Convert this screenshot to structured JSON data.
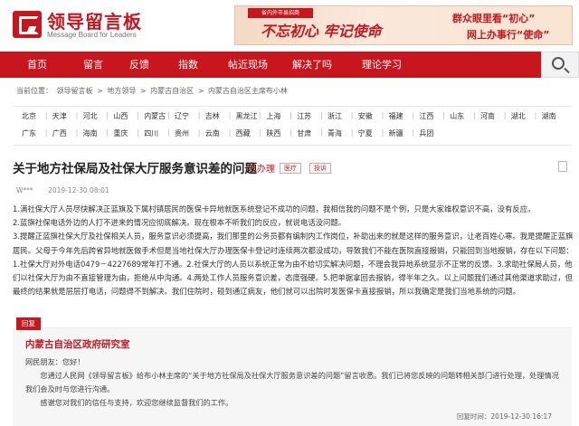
{
  "logo": {
    "cn": "领导留言板",
    "en": "Message Board for Leaders"
  },
  "banner": {
    "badge": "省内外市县招商",
    "slogan": "不忘初心 牢记使命",
    "line1": "群众眼里看“初心”",
    "line2": "网上办事行“使命”"
  },
  "nav": [
    "首页",
    "留言",
    "反馈",
    "指数",
    "帖近现场",
    "解决了吗",
    "理论学习"
  ],
  "breadcrumb": [
    "当前位置：",
    "领导留言板",
    ">",
    "地方领导",
    ">",
    "内蒙古自治区",
    ">",
    "内蒙古自治区主席布小林"
  ],
  "regions": {
    "row1": [
      "北京",
      "天津",
      "河北",
      "山西",
      "内蒙古",
      "辽宁",
      "吉林",
      "黑龙江",
      "上海",
      "江苏",
      "浙江",
      "安徽",
      "福建",
      "江西",
      "山东",
      "河南",
      "湖北",
      "湖南"
    ],
    "row2": [
      "广东",
      "广西",
      "海南",
      "重庆",
      "四川",
      "贵州",
      "云南",
      "西藏",
      "陕西",
      "甘肃",
      "青海",
      "宁夏",
      "新疆",
      "兵团"
    ]
  },
  "post": {
    "title": "关于地方社保局及社保大厅服务意识差的问题",
    "status": "已办理",
    "tags": [
      "医疗",
      "投诉"
    ],
    "author": "W***",
    "date": "2019-12-30 08:01",
    "paragraphs": [
      "1.满社保大厅人员尽快解决正蓝旗及下属村镇居民的医保卡异地就医系统登记不成功的问题，我相信我的问题不是个例，只是大家维权意识不高，没有反应。",
      "2.蓝旗社保电话外边的人打不进来的情况应彻底解决。现在根本不听我们的反应，就说电话没问题。",
      "3.提醒正蓝旗社保大厅及社保相关人员，服务意识必须提高，我们那里的公务员都有编制内工作岗位，补助出来的就是这样的服务意识，让老百姓心寒。我是提醒正蓝旗居民。父母于今年先后跨省异地就医做手术但是当地社保大厅办理医保卡登记时连续两次都没成功，导致我们不能在医院直接报销，只能回到当地报销，存在以下问题：1.社保大厅对外电话0479－4227689常年打不通。2.社保大厅的人员以系统正常为由不给切实解决问题，不理会我异地系统显示不正常的反馈。3.求助社保局人员，他们以社保大厅为由不直接管理为由，拒绝从中沟通。4.两处工作人员服务意识差，态度强硬。5.把单据拿回去报销，得半年之久。以上问题我们通过其他渠道求助过，但最终的结果就是层层打电话，问题得不到解决。我们住院时，碰到通辽病友，他们就可以出院时发医保卡直接报销，所以我确定是我们当地系统的问题。"
    ]
  },
  "reply": {
    "label": "回复",
    "org": "内蒙古自治区政府研究室",
    "greeting": "网民朋友：您好！",
    "body1": "您通过人民网《领导留言板》给布小林主席的“关于地方社保局及社保大厅服务意识差的问题”留言收悉。我们已将您反映的问题转相关部门进行处理，处理情况我们会及时与您进行沟通。",
    "body2": "感谢您对我们的信任与支持，欢迎您继续监督我们的工作。",
    "date": "回复时间：2019-12-30 16:17"
  },
  "colors": {
    "brand": "#c8161e"
  }
}
